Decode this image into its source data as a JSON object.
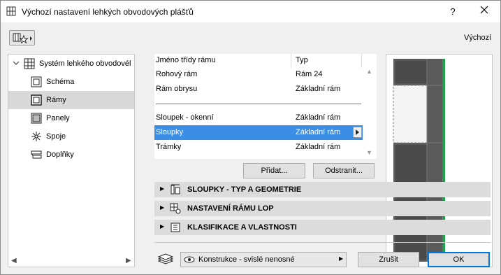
{
  "window": {
    "title": "Výchozí nastavení lehkých obvodových plášťů",
    "help_label": "?",
    "default_label": "Výchozí"
  },
  "tree": {
    "items": [
      {
        "label": "Systém lehkého obvodovél",
        "icon": "curtain-wall-system-icon",
        "level": 0
      },
      {
        "label": "Schéma",
        "icon": "scheme-icon",
        "level": 1
      },
      {
        "label": "Rámy",
        "icon": "frames-icon",
        "level": 1,
        "selected": true
      },
      {
        "label": "Panely",
        "icon": "panels-icon",
        "level": 1
      },
      {
        "label": "Spoje",
        "icon": "junctions-icon",
        "level": 1
      },
      {
        "label": "Doplňky",
        "icon": "accessories-icon",
        "level": 1
      }
    ]
  },
  "proplist": {
    "header": {
      "name": "Jméno třídy rámu",
      "type": "Typ"
    },
    "rows_top": [
      {
        "name": "Rohový rám",
        "type": "Rám 24"
      },
      {
        "name": "Rám obrysu",
        "type": "Základní rám"
      }
    ],
    "rows_bottom": [
      {
        "name": "Sloupek - okenní",
        "type": "Základní rám"
      },
      {
        "name": "Sloupky",
        "type": "Základní rám",
        "selected": true
      },
      {
        "name": "Trámky",
        "type": "Základní rám"
      }
    ]
  },
  "buttons": {
    "add": "Přidat...",
    "remove": "Odstranit...",
    "cancel": "Zrušit",
    "ok": "OK"
  },
  "sections": [
    {
      "label": "SLOUPKY - TYP A GEOMETRIE",
      "icon": "mullion-geometry-icon"
    },
    {
      "label": "NASTAVENÍ RÁMU LOP",
      "icon": "frame-settings-icon"
    },
    {
      "label": "KLASIFIKACE A VLASTNOSTI",
      "icon": "classification-icon"
    }
  ],
  "layer": {
    "value": "Konstrukce - svislé nenosné"
  },
  "colors": {
    "selection": "#3a8ee6",
    "tree_selection": "#d9d9d9",
    "section_bg": "#dcdcdc",
    "accent_green": "#1fa04a"
  }
}
